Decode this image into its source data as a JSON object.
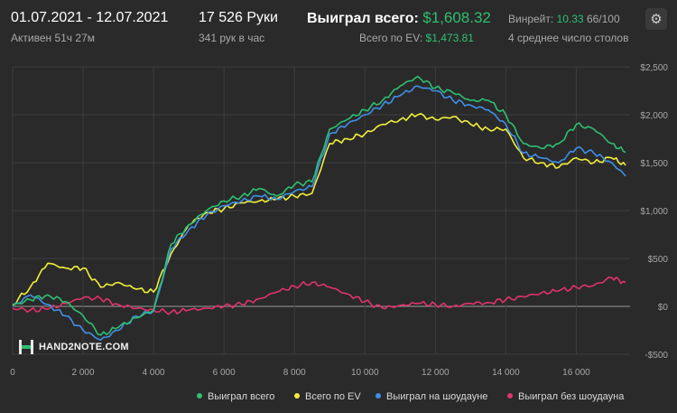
{
  "header": {
    "date_range": "01.07.2021 - 12.07.2021",
    "active": "Активен 51ч 27м",
    "hands": "17 526 Руки",
    "hands_per_hour": "341 рук в час",
    "won_total_label": "Выиграл всего:",
    "won_total_value": "$1,608.32",
    "ev_total_label": "Всего по EV:",
    "ev_total_value": "$1,473.81",
    "winrate_label": "Винрейт:",
    "winrate_value": "10.33",
    "winrate_suffix": "66/100",
    "tables": "4 среднее число столов"
  },
  "logo": {
    "text": "HAND2NOTE.COM"
  },
  "icons": {
    "settings": "gear-icon",
    "logo": "hand2note-logo-icon"
  },
  "colors": {
    "won_total": "#2fbf71",
    "ev_total": "#f2ef3a",
    "showdown": "#3f8fe8",
    "non_showdown": "#e0336a",
    "background": "#2a2a2a"
  },
  "chart_data": {
    "type": "line",
    "xlim": [
      0,
      17526
    ],
    "ylim": [
      -500,
      2500
    ],
    "x_ticks": [
      "0",
      "2 000",
      "4 000",
      "6 000",
      "8 000",
      "10 000",
      "12 000",
      "14 000",
      "16 000"
    ],
    "y_ticks": [
      "-$500",
      "$0",
      "$500",
      "$1,000",
      "$1,500",
      "$2,000",
      "$2,500"
    ],
    "y_tick_values": [
      -500,
      0,
      500,
      1000,
      1500,
      2000,
      2500
    ],
    "x_tick_values": [
      0,
      2000,
      4000,
      6000,
      8000,
      10000,
      12000,
      14000,
      16000
    ],
    "grid": true,
    "legend_position": "bottom",
    "x": [
      0,
      500,
      1000,
      1500,
      2000,
      2500,
      3000,
      3500,
      4000,
      4500,
      5000,
      5500,
      6000,
      6500,
      7000,
      7500,
      8000,
      8500,
      9000,
      9500,
      10000,
      10500,
      11000,
      11500,
      12000,
      12500,
      13000,
      13500,
      14000,
      14500,
      15000,
      15500,
      16000,
      16500,
      17000,
      17400
    ],
    "series": [
      {
        "name": "Выиграл всего",
        "color": "#2fbf71",
        "values": [
          10,
          70,
          120,
          50,
          -100,
          -300,
          -220,
          -120,
          -40,
          650,
          850,
          1000,
          1100,
          1150,
          1230,
          1150,
          1270,
          1300,
          1850,
          1950,
          2050,
          2150,
          2300,
          2400,
          2280,
          2230,
          2150,
          2150,
          2000,
          1700,
          1650,
          1700,
          1900,
          1850,
          1700,
          1608
        ]
      },
      {
        "name": "Всего по EV",
        "color": "#f2ef3a",
        "values": [
          20,
          200,
          450,
          400,
          400,
          200,
          250,
          180,
          150,
          550,
          850,
          980,
          1020,
          1080,
          1100,
          1120,
          1150,
          1180,
          1700,
          1750,
          1800,
          1900,
          1950,
          2000,
          1950,
          1980,
          1900,
          1850,
          1850,
          1550,
          1500,
          1450,
          1550,
          1500,
          1550,
          1474
        ]
      },
      {
        "name": "Выиграл на шоудауне",
        "color": "#3f8fe8",
        "values": [
          0,
          120,
          20,
          -100,
          -250,
          -350,
          -250,
          -100,
          -50,
          600,
          800,
          950,
          1050,
          1100,
          1150,
          1120,
          1200,
          1250,
          1800,
          1900,
          2000,
          2100,
          2200,
          2300,
          2250,
          2150,
          2100,
          2050,
          1900,
          1600,
          1550,
          1500,
          1650,
          1600,
          1500,
          1360
        ]
      },
      {
        "name": "Выиграл без шоудауна",
        "color": "#e0336a",
        "values": [
          -20,
          -40,
          -30,
          30,
          90,
          80,
          20,
          -20,
          -40,
          -60,
          -40,
          -20,
          0,
          20,
          80,
          150,
          210,
          250,
          200,
          130,
          50,
          -20,
          10,
          30,
          20,
          0,
          30,
          40,
          70,
          100,
          140,
          160,
          200,
          220,
          300,
          250
        ]
      }
    ]
  }
}
